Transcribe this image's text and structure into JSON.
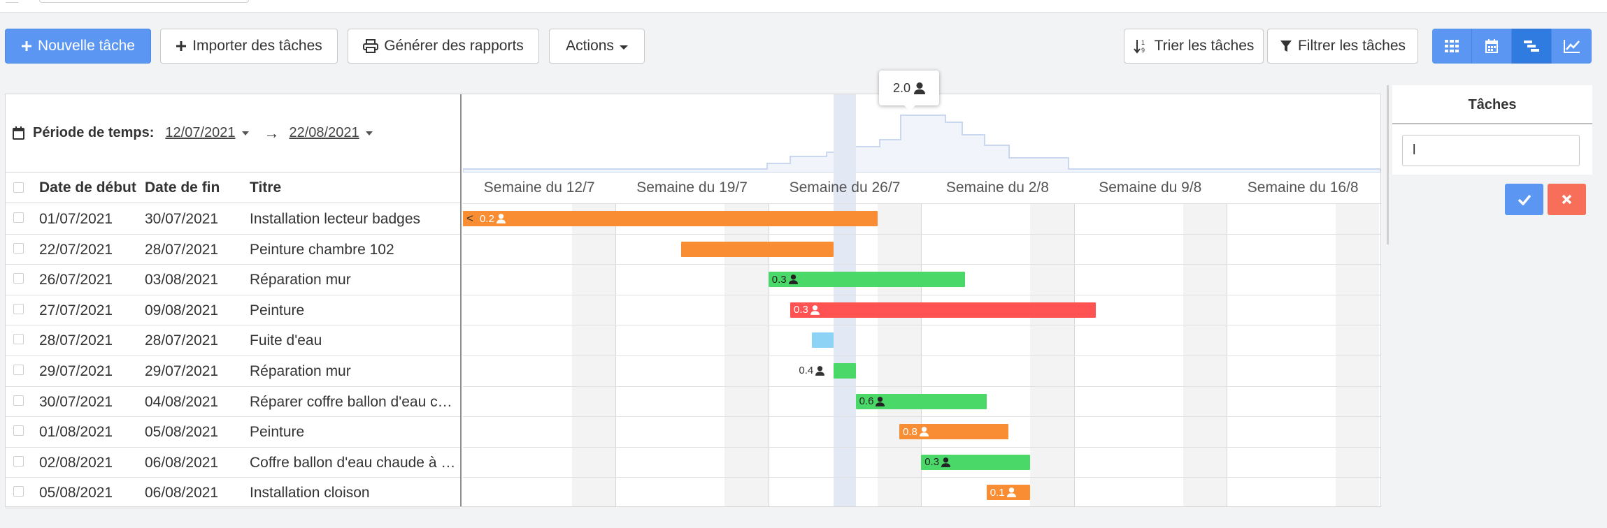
{
  "toolbar": {
    "new_task": "Nouvelle tâche",
    "import_tasks": "Importer des tâches",
    "generate_reports": "Générer des rapports",
    "actions": "Actions",
    "sort_tasks": "Trier les tâches",
    "filter_tasks": "Filtrer les tâches"
  },
  "period": {
    "label": "Période de temps:",
    "start": "12/07/2021",
    "end": "22/08/2021",
    "arrow": "→"
  },
  "columns": {
    "start": "Date de début",
    "end": "Date de fin",
    "title": "Titre"
  },
  "tasks": [
    {
      "start": "01/07/2021",
      "end": "30/07/2021",
      "title": "Installation lecteur badges",
      "load": "0.2",
      "color": "orange"
    },
    {
      "start": "22/07/2021",
      "end": "28/07/2021",
      "title": "Peinture chambre 102",
      "load": "",
      "color": "orange"
    },
    {
      "start": "26/07/2021",
      "end": "03/08/2021",
      "title": "Réparation mur",
      "load": "0.3",
      "color": "green"
    },
    {
      "start": "27/07/2021",
      "end": "09/08/2021",
      "title": "Peinture",
      "load": "0.3",
      "color": "red"
    },
    {
      "start": "28/07/2021",
      "end": "28/07/2021",
      "title": "Fuite d'eau",
      "load": "",
      "color": "blue"
    },
    {
      "start": "29/07/2021",
      "end": "29/07/2021",
      "title": "Réparation mur",
      "load": "0.4",
      "color": "green"
    },
    {
      "start": "30/07/2021",
      "end": "04/08/2021",
      "title": "Réparer coffre ballon d'eau chaude",
      "load": "0.6",
      "color": "green"
    },
    {
      "start": "01/08/2021",
      "end": "05/08/2021",
      "title": "Peinture",
      "load": "0.8",
      "color": "orange"
    },
    {
      "start": "02/08/2021",
      "end": "06/08/2021",
      "title": "Coffre ballon d'eau chaude à refaire",
      "load": "0.3",
      "color": "green"
    },
    {
      "start": "05/08/2021",
      "end": "06/08/2021",
      "title": "Installation cloison",
      "load": "0.1",
      "color": "orange"
    }
  ],
  "weeks": [
    "Semaine du 12/7",
    "Semaine du 19/7",
    "Semaine du 26/7",
    "Semaine du 2/8",
    "Semaine du 9/8",
    "Semaine du 16/8"
  ],
  "tooltip": {
    "value": "2.0"
  },
  "side_panel": {
    "title": "Tâches",
    "input_value": "l"
  },
  "colors": {
    "primary": "#5b97f2",
    "orange": "#f98d33",
    "green": "#4ad868",
    "red": "#ff5252",
    "blue": "#8dd3f6",
    "cancel": "#f76e59"
  }
}
